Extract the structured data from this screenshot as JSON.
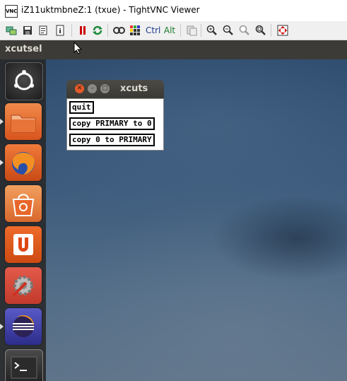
{
  "window": {
    "title": "iZ11uktmbneZ:1 (txue) - TightVNC Viewer",
    "app_icon_text": "VNC"
  },
  "toolbar": {
    "ctrl_label": "Ctrl",
    "alt_label": "Alt"
  },
  "panel": {
    "title": "xcutsel"
  },
  "xcutsel": {
    "title": "xcuts",
    "quit": "quit",
    "copy_primary": "copy PRIMARY to 0",
    "copy_zero": "copy 0 to PRIMARY"
  },
  "launcher": {
    "items": [
      "dash-home",
      "files",
      "firefox",
      "ubuntu-software-center",
      "ubuntu-one",
      "system-settings",
      "eclipse",
      "terminal"
    ]
  }
}
